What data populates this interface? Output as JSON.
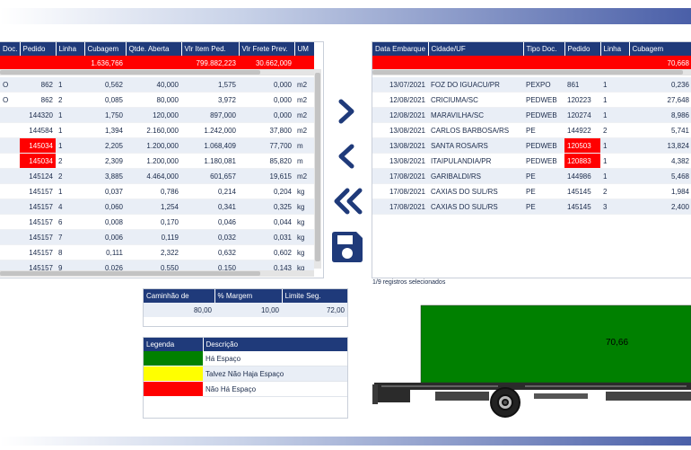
{
  "left_table": {
    "headers": [
      "Doc.",
      "Pedido",
      "Linha",
      "Cubagem",
      "Qtde. Aberta",
      "Vlr Item Ped.",
      "Vlr Frete Prev.",
      "UM"
    ],
    "totals": [
      "",
      "",
      "",
      "1.636,766",
      "",
      "799.882,223",
      "30.662,009",
      ""
    ],
    "rows": [
      [
        "O",
        "862",
        "1",
        "0,562",
        "40,000",
        "1,575",
        "0,000",
        "m2"
      ],
      [
        "O",
        "862",
        "2",
        "0,085",
        "80,000",
        "3,972",
        "0,000",
        "m2"
      ],
      [
        "",
        "144320",
        "1",
        "1,750",
        "120,000",
        "897,000",
        "0,000",
        "m2"
      ],
      [
        "",
        "144584",
        "1",
        "1,394",
        "2.160,000",
        "1.242,000",
        "37,800",
        "m2"
      ],
      [
        "",
        "145034",
        "1",
        "2,205",
        "1.200,000",
        "1.068,409",
        "77,700",
        "m"
      ],
      [
        "",
        "145034",
        "2",
        "2,309",
        "1.200,000",
        "1.180,081",
        "85,820",
        "m"
      ],
      [
        "",
        "145124",
        "2",
        "3,885",
        "4.464,000",
        "601,657",
        "19,615",
        "m2"
      ],
      [
        "",
        "145157",
        "1",
        "0,037",
        "0,786",
        "0,214",
        "0,204",
        "kg"
      ],
      [
        "",
        "145157",
        "4",
        "0,060",
        "1,254",
        "0,341",
        "0,325",
        "kg"
      ],
      [
        "",
        "145157",
        "6",
        "0,008",
        "0,170",
        "0,046",
        "0,044",
        "kg"
      ],
      [
        "",
        "145157",
        "7",
        "0,006",
        "0,119",
        "0,032",
        "0,031",
        "kg"
      ],
      [
        "",
        "145157",
        "8",
        "0,111",
        "2,322",
        "0,632",
        "0,602",
        "kg"
      ],
      [
        "",
        "145157",
        "9",
        "0,026",
        "0,550",
        "0,150",
        "0,143",
        "kg"
      ]
    ]
  },
  "right_table": {
    "headers": [
      "Data Embarque",
      "Cidade/UF",
      "Tipo Doc.",
      "Pedido",
      "Linha",
      "Cubagem"
    ],
    "totals": [
      "",
      "",
      "",
      "",
      "",
      "70,668"
    ],
    "rows": [
      [
        "13/07/2021",
        "FOZ DO IGUACU/PR",
        "PEXPO",
        "861",
        "1",
        "0,236"
      ],
      [
        "12/08/2021",
        "CRICIUMA/SC",
        "PEDWEB",
        "120223",
        "1",
        "27,648"
      ],
      [
        "12/08/2021",
        "MARAVILHA/SC",
        "PEDWEB",
        "120274",
        "1",
        "8,986"
      ],
      [
        "13/08/2021",
        "CARLOS BARBOSA/RS",
        "PE",
        "144922",
        "2",
        "5,741"
      ],
      [
        "13/08/2021",
        "SANTA ROSA/RS",
        "PEDWEB",
        "120503",
        "1",
        "13,824"
      ],
      [
        "13/08/2021",
        "ITAIPULANDIA/PR",
        "PEDWEB",
        "120883",
        "1",
        "4,382"
      ],
      [
        "17/08/2021",
        "GARIBALDI/RS",
        "PE",
        "144986",
        "1",
        "5,468"
      ],
      [
        "17/08/2021",
        "CAXIAS DO SUL/RS",
        "PE",
        "145145",
        "2",
        "1,984"
      ],
      [
        "17/08/2021",
        "CAXIAS DO SUL/RS",
        "PE",
        "145145",
        "3",
        "2,400"
      ]
    ]
  },
  "status_text": "1/9 registros selecionados",
  "capacity": {
    "headers": [
      "Caminhão de",
      "% Margem",
      "Limite Seg."
    ],
    "values": [
      "80,00",
      "10,00",
      "72,00"
    ]
  },
  "legend": {
    "headers": [
      "Legenda",
      "Descrição"
    ],
    "items": [
      {
        "color": "#008000",
        "label": "Há Espaço"
      },
      {
        "color": "#ffff00",
        "label": "Talvez Não Haja Espaço"
      },
      {
        "color": "#ff0000",
        "label": "Não Há Espaço"
      }
    ]
  },
  "truck_load_label": "70,66",
  "truck_load_color": "#008000",
  "icons": [
    "chevron-right-icon",
    "chevron-left-icon",
    "double-chevron-left-icon",
    "save-icon"
  ],
  "accent_color": "#1f3a7a"
}
